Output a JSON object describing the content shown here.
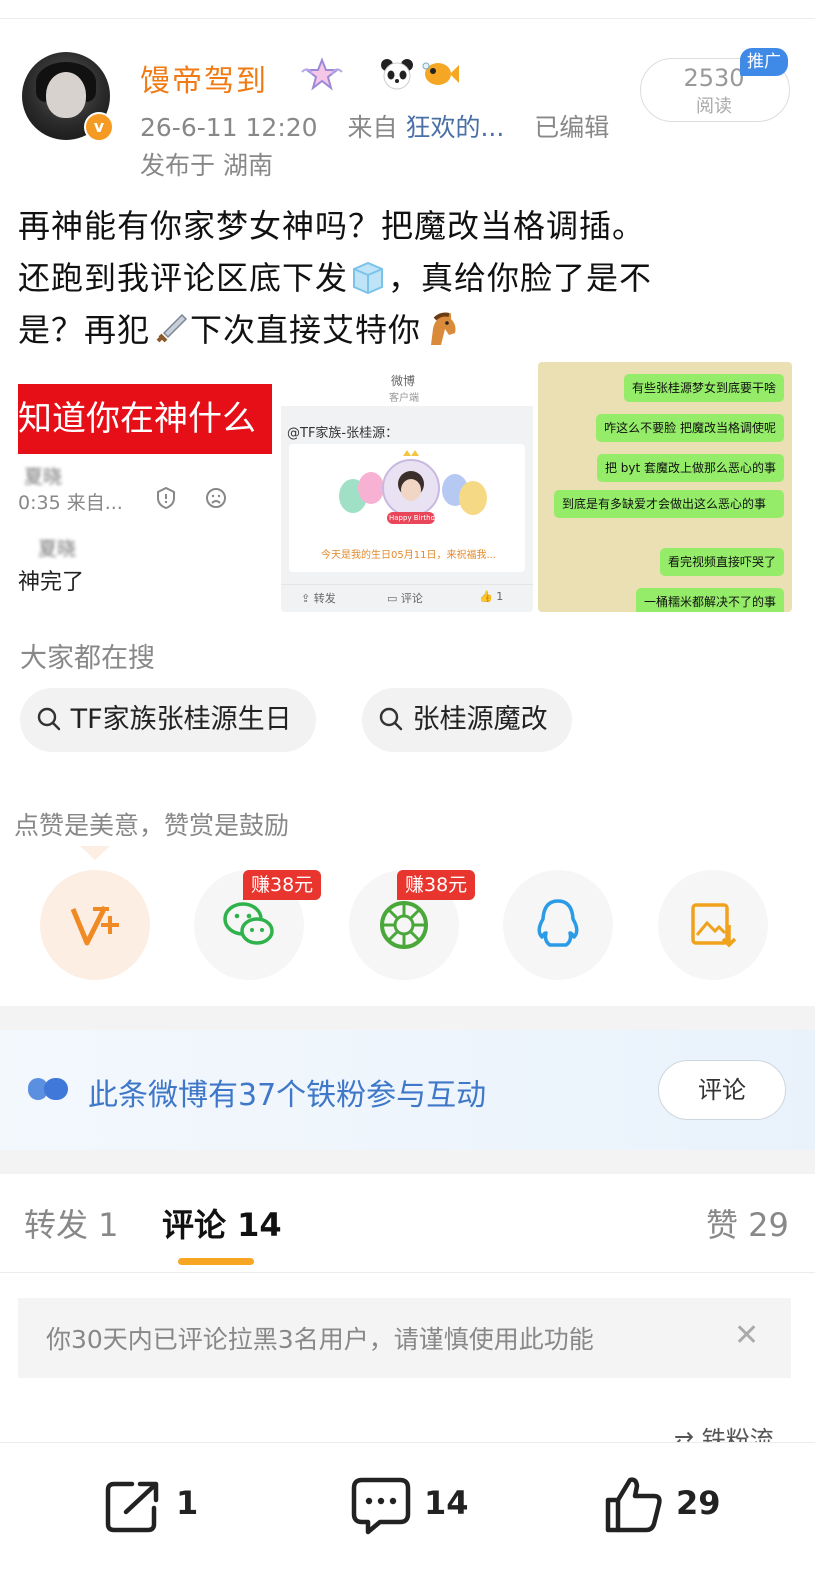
{
  "post": {
    "username": "馒帝驾到",
    "time": "26-6-11 12:20",
    "from_label": "来自",
    "source": "狂欢的...",
    "edited": "已编辑",
    "location": "发布于 湖南",
    "read_count": "2530",
    "read_label": "阅读",
    "promo_badge": "推广",
    "content_line1": "再神能有你家梦女神吗？把魔改当格调插。",
    "content_line2a": "还跑到我评论区底下发",
    "content_line2b": "，真给你脸了是不",
    "content_line3a": "是？再犯",
    "content_line3b": "下次直接艾特你"
  },
  "images": {
    "img1": {
      "banner": "知道你在神什么",
      "name_blur": "夏晓",
      "time": "0:35 来自...",
      "reply_blur": "夏晓",
      "reply_text": "神完了"
    },
    "img2": {
      "header_title": "微博",
      "header_sub": "客户端",
      "mention": "@TF家族-张桂源：",
      "birthday_banner": "Happy Birthday",
      "caption": "今天是我的生日05月11日，来祝福我...",
      "repost": "转发",
      "comment": "评论",
      "like": "1"
    },
    "img3": {
      "bubbles": [
        "有些张桂源梦女到底要干啥",
        "咋这么不要脸 把魔改当格调使呢",
        "把 byt 套魔改上做那么恶心的事",
        "到底是有多缺爱才会做出这么恶心的事",
        "看完视频直接吓哭了",
        "一桶糯米都解决不了的事"
      ]
    }
  },
  "search": {
    "title": "大家都在搜",
    "pills": [
      "TF家族张桂源生日",
      "张桂源魔改"
    ]
  },
  "reward": {
    "hint": "点赞是美意，赞赏是鼓励",
    "earn_badge": "赚38元",
    "buttons": [
      "reward-v-icon",
      "wechat-icon",
      "moments-icon",
      "qq-icon",
      "save-image-icon"
    ]
  },
  "fans": {
    "text": "此条微博有37个铁粉参与互动",
    "button": "评论"
  },
  "tabs": {
    "repost": "转发 1",
    "comment": "评论 14",
    "like": "赞 29"
  },
  "notice": {
    "text": "你30天内已评论拉黑3名用户，请谨慎使用此功能",
    "close": "✕"
  },
  "fan_sort": "铁粉流",
  "bottom": {
    "repost_count": "1",
    "comment_count": "14",
    "like_count": "29"
  },
  "colors": {
    "accent_orange": "#f07b15",
    "link_blue": "#4a6fa5",
    "tab_underline": "#f6a623",
    "earn_red": "#e8352e"
  }
}
